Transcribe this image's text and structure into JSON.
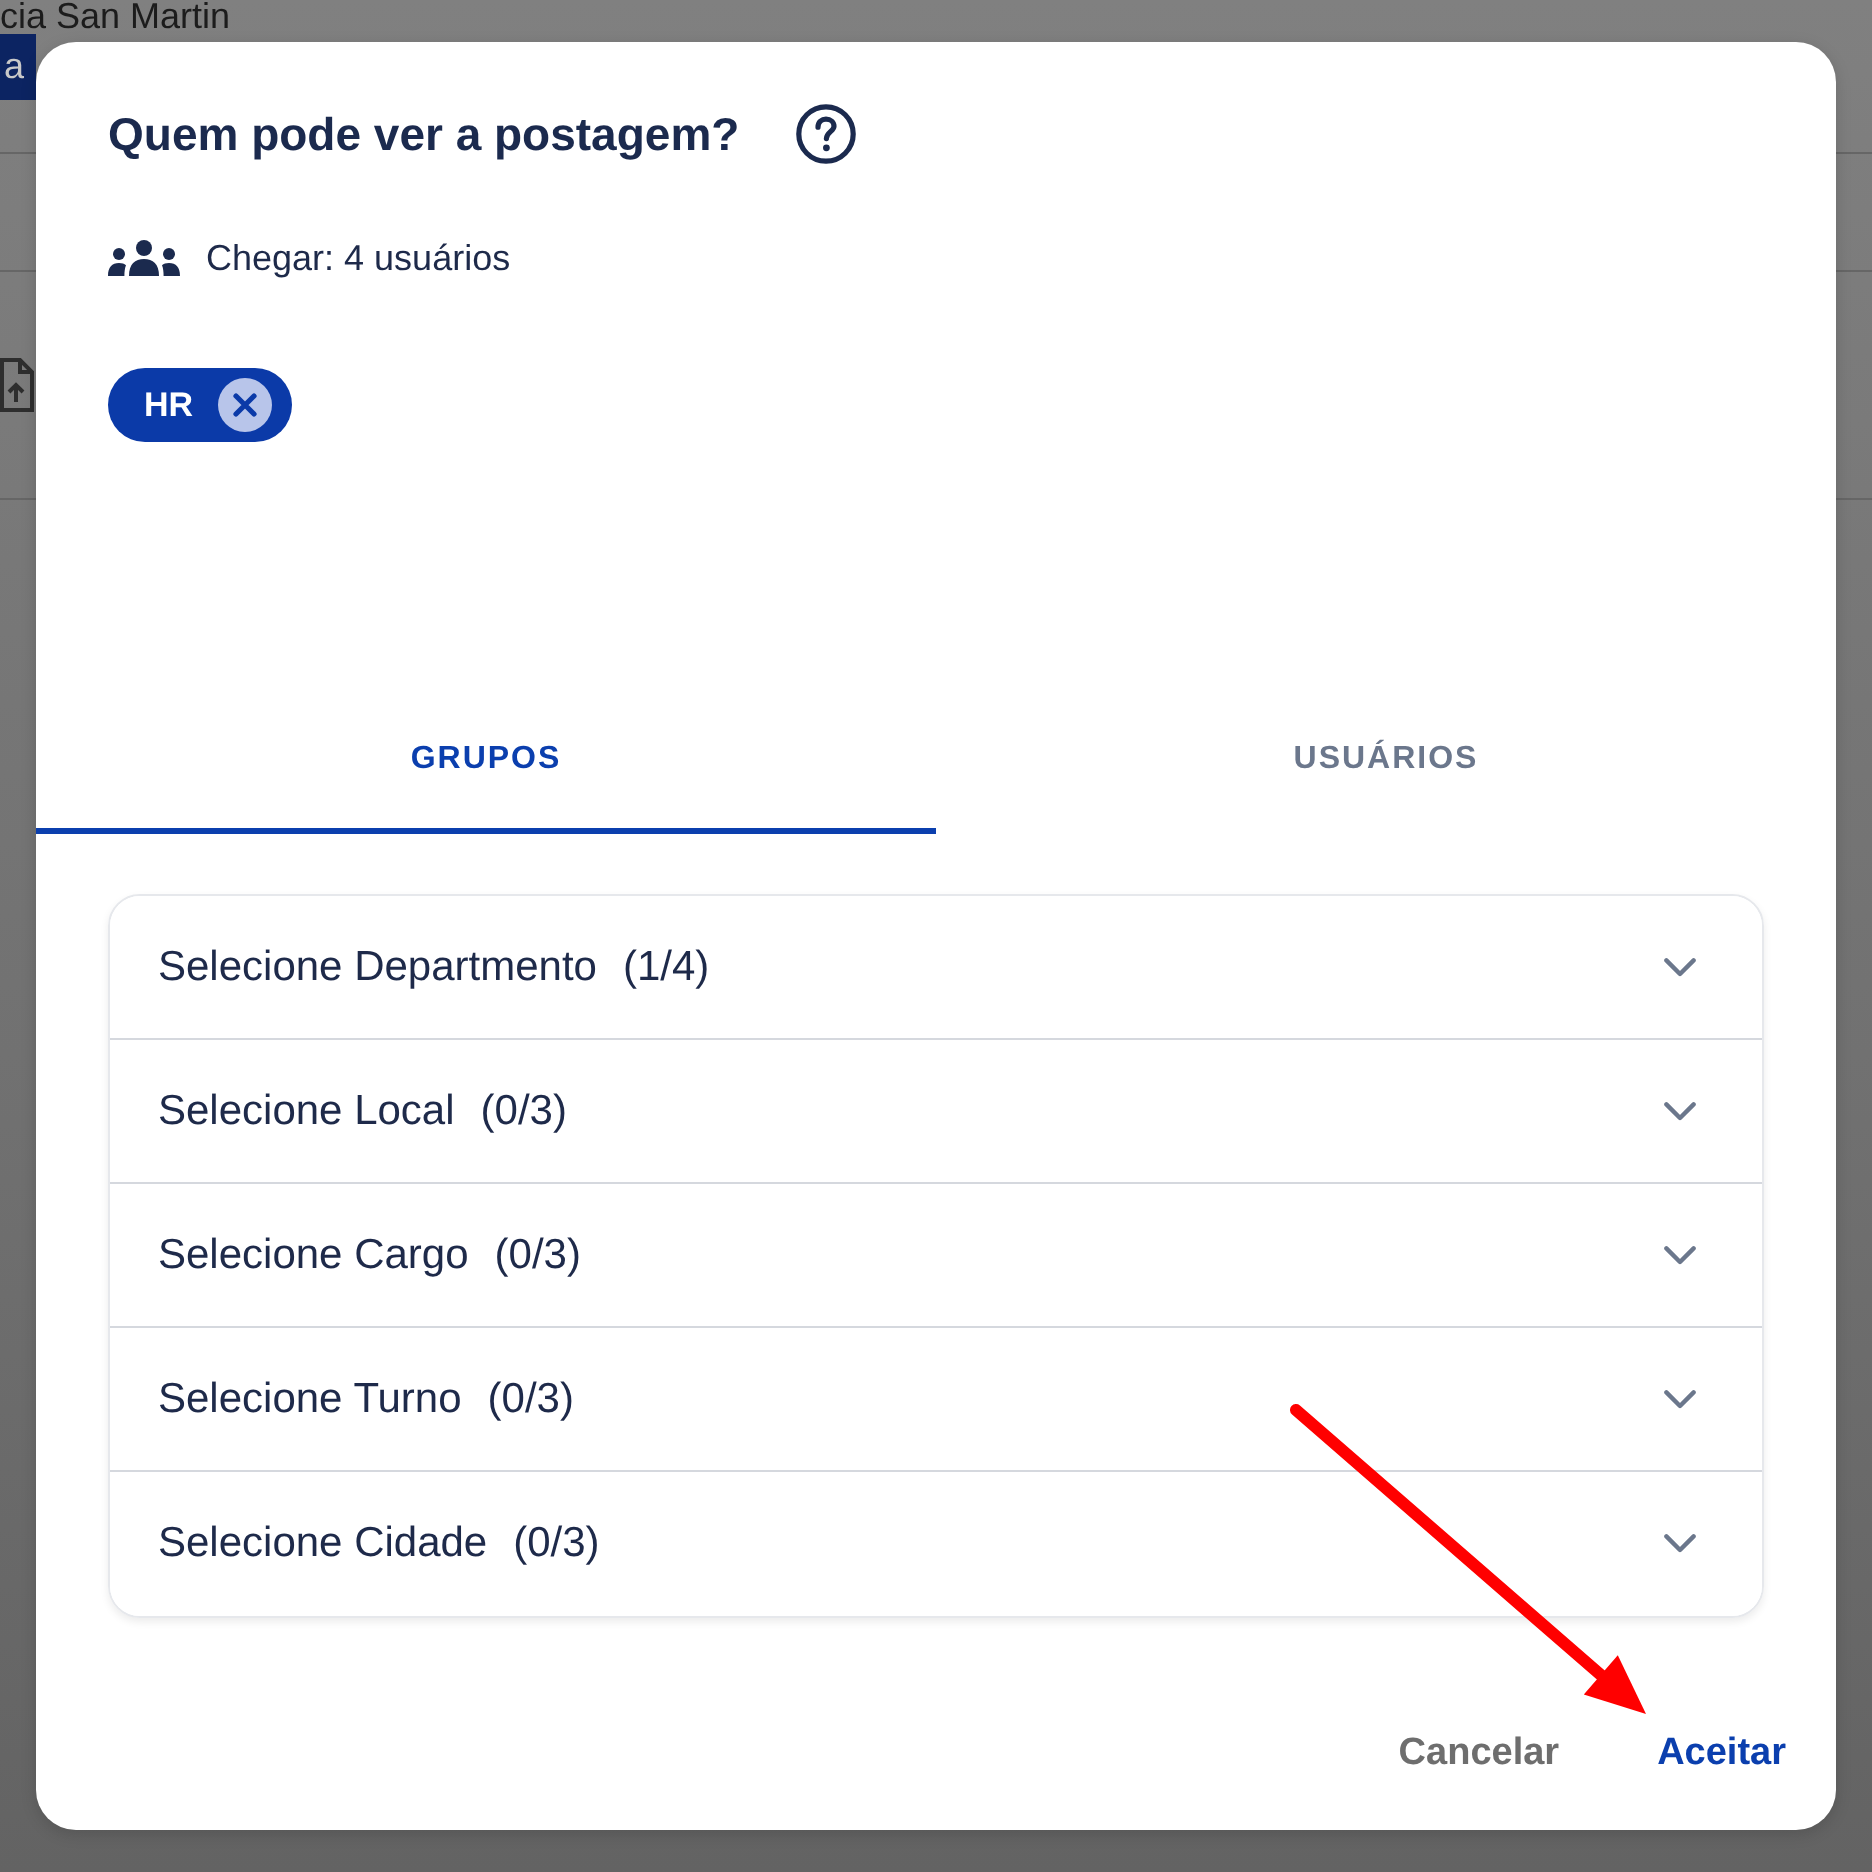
{
  "background": {
    "heading": "cia San Martin",
    "pill": "a"
  },
  "dialog": {
    "title": "Quem pode ver a postagem?",
    "reach": "Chegar: 4 usuários",
    "chips": [
      {
        "label": "HR"
      }
    ]
  },
  "tabs": [
    {
      "label": "GRUPOS",
      "selected": true
    },
    {
      "label": "USUÁRIOS",
      "selected": false
    }
  ],
  "groups": [
    {
      "label": "Selecione Departmento",
      "count": "(1/4)",
      "expanded": false
    },
    {
      "label": "Selecione Local",
      "count": "(0/3)",
      "expanded": false
    },
    {
      "label": "Selecione Cargo",
      "count": "(0/3)",
      "expanded": false
    },
    {
      "label": "Selecione Turno",
      "count": "(0/3)",
      "expanded": false
    },
    {
      "label": "Selecione Cidade",
      "count": "(0/3)",
      "expanded": false
    }
  ],
  "buttons": [
    {
      "label": "Cancelar",
      "kind": "secondary"
    },
    {
      "label": "Aceitar",
      "kind": "primary"
    }
  ]
}
